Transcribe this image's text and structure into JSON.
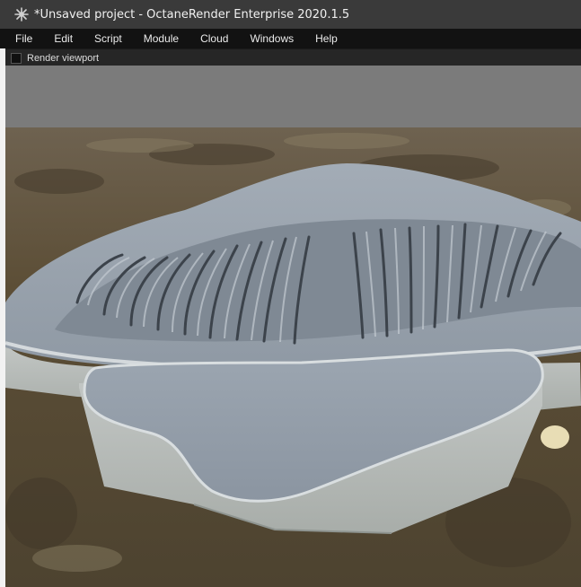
{
  "window": {
    "title": "*Unsaved project - OctaneRender Enterprise 2020.1.5",
    "app_icon": "octane-logo-icon"
  },
  "menu": {
    "items": [
      {
        "label": "File"
      },
      {
        "label": "Edit"
      },
      {
        "label": "Script"
      },
      {
        "label": "Module"
      },
      {
        "label": "Cloud"
      },
      {
        "label": "Windows"
      },
      {
        "label": "Help"
      }
    ]
  },
  "panel": {
    "title": "Render viewport",
    "icon": "panel-square-icon"
  },
  "colors": {
    "titlebar": "#3a3a3a",
    "menubar": "#121212",
    "viewport_gray": "#7b7b7b",
    "model": "#a9b2ba",
    "ground": "#5d4f37"
  }
}
